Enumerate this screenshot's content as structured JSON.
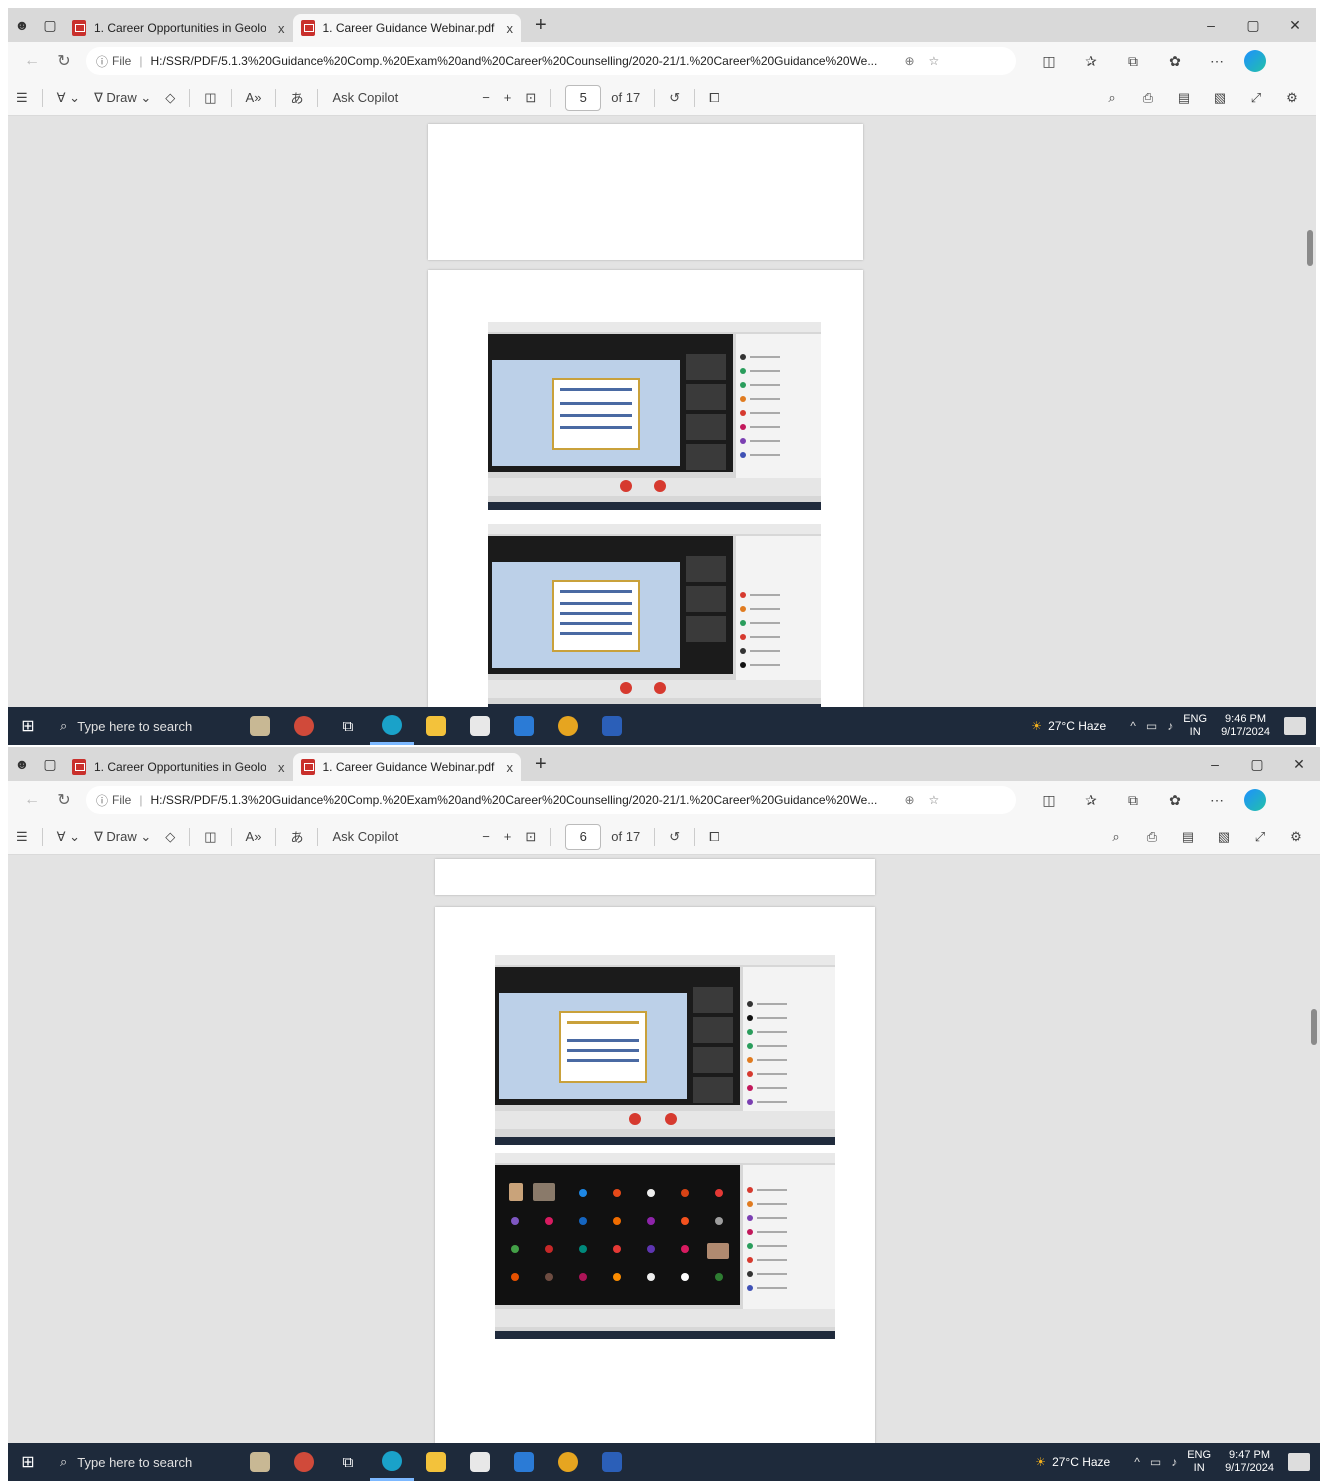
{
  "screens": [
    {
      "tabs": [
        {
          "label": "1. Career Opportunities in Geolo",
          "close": "x"
        },
        {
          "label": "1. Career Guidance Webinar.pdf",
          "close": "x"
        }
      ],
      "new_tab": "+",
      "window_controls": [
        "–",
        "▢",
        "✕"
      ],
      "address": {
        "scheme_label": "File",
        "url": "H:/SSR/PDF/5.1.3%20Guidance%20Comp.%20Exam%20and%20Career%20Counselling/2020-21/1.%20Career%20Guidance%20We..."
      },
      "pdf_toolbar": {
        "draw_label": "Draw",
        "ask_copilot": "Ask Copilot",
        "zoom_out": "−",
        "zoom_in": "+",
        "page_current": "5",
        "page_total": "of 17"
      },
      "taskbar": {
        "search_placeholder": "Type here to search",
        "weather": "27°C Haze",
        "lang_top": "ENG",
        "lang_bottom": "IN",
        "time": "9:46 PM",
        "date": "9/17/2024"
      }
    },
    {
      "tabs": [
        {
          "label": "1. Career Opportunities in Geolo",
          "close": "x"
        },
        {
          "label": "1. Career Guidance Webinar.pdf",
          "close": "x"
        }
      ],
      "new_tab": "+",
      "window_controls": [
        "–",
        "▢",
        "✕"
      ],
      "address": {
        "scheme_label": "File",
        "url": "H:/SSR/PDF/5.1.3%20Guidance%20Comp.%20Exam%20and%20Career%20Counselling/2020-21/1.%20Career%20Guidance%20We..."
      },
      "pdf_toolbar": {
        "draw_label": "Draw",
        "ask_copilot": "Ask Copilot",
        "zoom_out": "−",
        "zoom_in": "+",
        "page_current": "6",
        "page_total": "of 17"
      },
      "taskbar": {
        "search_placeholder": "Type here to search",
        "weather": "27°C Haze",
        "lang_top": "ENG",
        "lang_bottom": "IN",
        "time": "9:47 PM",
        "date": "9/17/2024"
      }
    }
  ],
  "colors": {
    "pdf_icon": "#c9302c",
    "taskbar": "#1e2a3b",
    "viewer_bg": "#e3e3e3",
    "meeting_end_red": "#d63a2f"
  },
  "icons": [
    "profile-icon",
    "tab-actions-icon",
    "pdf-file-icon",
    "back-icon",
    "refresh-icon",
    "info-icon",
    "zoom-icon",
    "favorite-star-icon",
    "split-screen-icon",
    "favorites-icon",
    "collections-icon",
    "extensions-icon",
    "more-icon",
    "copilot-icon",
    "contents-icon",
    "highlight-icon",
    "draw-icon",
    "erase-icon",
    "view-icon",
    "read-aloud-icon",
    "translate-icon",
    "fit-page-icon",
    "rotate-icon",
    "two-page-icon",
    "search-icon",
    "print-icon",
    "save-icon",
    "save-as-icon",
    "fullscreen-icon",
    "settings-icon",
    "windows-start-icon",
    "task-view-icon",
    "edge-icon",
    "file-explorer-icon",
    "store-icon",
    "mail-icon",
    "chrome-icon",
    "word-icon",
    "weather-icon",
    "notifications-icon"
  ]
}
